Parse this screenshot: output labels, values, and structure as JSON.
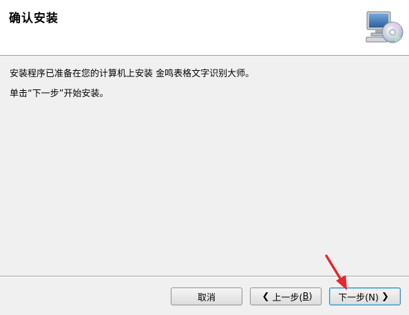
{
  "header": {
    "title": "确认安装",
    "icon": "computer-disc-icon"
  },
  "content": {
    "line1": "安装程序已准备在您的计算机上安装 金鸣表格文字识别大师。",
    "line2": "单击“下一步”开始安装。"
  },
  "buttons": {
    "cancel": "取消",
    "back_prefix": "上一步(",
    "back_key": "B",
    "back_suffix": ")",
    "next": "下一步(N)"
  },
  "annotation": {
    "arrow_color": "#e8262b",
    "arrow_icon": "red-arrow-pointer-icon"
  }
}
